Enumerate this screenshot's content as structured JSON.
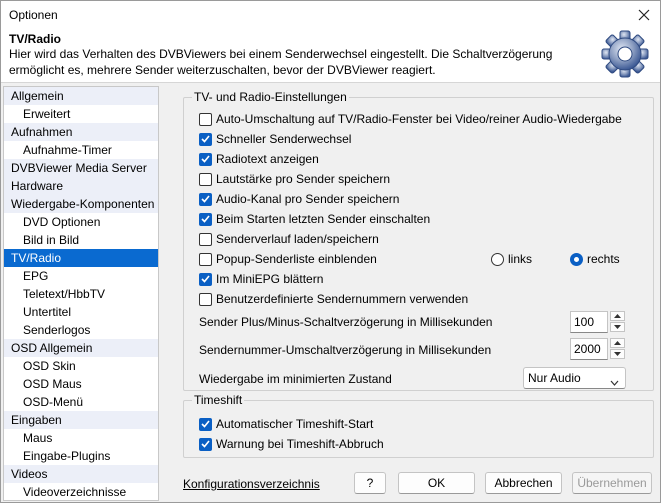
{
  "window": {
    "title": "Optionen"
  },
  "header": {
    "title": "TV/Radio",
    "description": "Hier wird das Verhalten des DVBViewers bei einem Senderwechsel eingestellt. Die Schaltverzögerung ermöglicht es, mehrere Sender weiterzuschalten, bevor der DVBViewer reagiert."
  },
  "sidebar": {
    "items": [
      {
        "label": "Allgemein",
        "level": 0
      },
      {
        "label": "Erweitert",
        "level": 1
      },
      {
        "label": "Aufnahmen",
        "level": 0
      },
      {
        "label": "Aufnahme-Timer",
        "level": 1
      },
      {
        "label": "DVBViewer Media Server",
        "level": 0
      },
      {
        "label": "Hardware",
        "level": 0
      },
      {
        "label": "Wiedergabe-Komponenten",
        "level": 0
      },
      {
        "label": "DVD Optionen",
        "level": 1
      },
      {
        "label": "Bild in Bild",
        "level": 1
      },
      {
        "label": "TV/Radio",
        "level": 0,
        "selected": true
      },
      {
        "label": "EPG",
        "level": 1
      },
      {
        "label": "Teletext/HbbTV",
        "level": 1
      },
      {
        "label": "Untertitel",
        "level": 1
      },
      {
        "label": "Senderlogos",
        "level": 1
      },
      {
        "label": "OSD Allgemein",
        "level": 0
      },
      {
        "label": "OSD Skin",
        "level": 1
      },
      {
        "label": "OSD Maus",
        "level": 1
      },
      {
        "label": "OSD-Menü",
        "level": 1
      },
      {
        "label": "Eingaben",
        "level": 0
      },
      {
        "label": "Maus",
        "level": 1
      },
      {
        "label": "Eingabe-Plugins",
        "level": 1
      },
      {
        "label": "Videos",
        "level": 0
      },
      {
        "label": "Videoverzeichnisse",
        "level": 1
      }
    ]
  },
  "tv_group": {
    "legend": "TV- und Radio-Einstellungen",
    "checkboxes": [
      {
        "label": "Auto-Umschaltung auf TV/Radio-Fenster bei Video/reiner Audio-Wiedergabe",
        "checked": false
      },
      {
        "label": "Schneller Senderwechsel",
        "checked": true
      },
      {
        "label": "Radiotext anzeigen",
        "checked": true
      },
      {
        "label": "Lautstärke pro Sender speichern",
        "checked": false
      },
      {
        "label": "Audio-Kanal pro Sender speichern",
        "checked": true
      },
      {
        "label": "Beim Starten letzten Sender einschalten",
        "checked": true
      },
      {
        "label": "Senderverlauf laden/speichern",
        "checked": false
      },
      {
        "label": "Popup-Senderliste einblenden",
        "checked": false
      },
      {
        "label": "Im MiniEPG blättern",
        "checked": true
      },
      {
        "label": "Benutzerdefinierte Sendernummern verwenden",
        "checked": false
      }
    ],
    "radios": [
      {
        "label": "links",
        "selected": false
      },
      {
        "label": "rechts",
        "selected": true
      }
    ],
    "spin1": {
      "label": "Sender Plus/Minus-Schaltverzögerung in Millisekunden",
      "value": "100"
    },
    "spin2": {
      "label": "Sendernummer-Umschaltverzögerung in Millisekunden",
      "value": "2000"
    },
    "minimized": {
      "label": "Wiedergabe im minimierten Zustand",
      "value": "Nur Audio"
    }
  },
  "timeshift_group": {
    "legend": "Timeshift",
    "checkboxes": [
      {
        "label": "Automatischer Timeshift-Start",
        "checked": true
      },
      {
        "label": "Warnung bei Timeshift-Abbruch",
        "checked": true
      }
    ]
  },
  "footer": {
    "config_link": "Konfigurationsverzeichnis",
    "help": "?",
    "ok": "OK",
    "cancel": "Abbrechen",
    "apply": "Übernehmen"
  },
  "colors": {
    "accent": "#0a5fc4",
    "selection": "#0a6ad0"
  }
}
